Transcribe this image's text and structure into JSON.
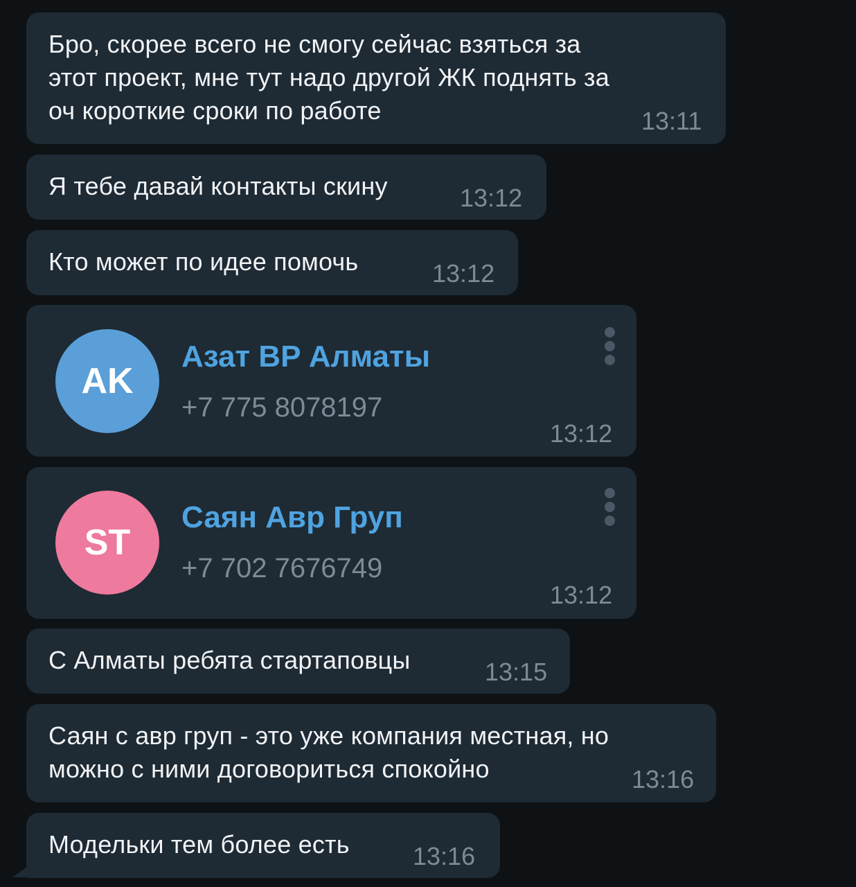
{
  "messages": [
    {
      "text": "Бро, скорее всего не смогу сейчас взяться за\nэтот проект, мне тут надо другой ЖК поднять за\nоч короткие сроки по работе",
      "time": "13:11"
    },
    {
      "text": "Я тебе давай контакты скину",
      "time": "13:12"
    },
    {
      "text": "Кто может по идее помочь",
      "time": "13:12"
    },
    {
      "text": "С Алматы ребята стартаповцы",
      "time": "13:15"
    },
    {
      "text": "Саян с авр груп - это уже компания местная, но\nможно с ними договориться спокойно",
      "time": "13:16"
    },
    {
      "text": "Модельки тем более есть",
      "time": "13:16"
    }
  ],
  "contacts": [
    {
      "initials": "AK",
      "name": "Азат BP Алматы",
      "phone": "+7 775 8078197",
      "time": "13:12",
      "avatar_color": "#5a9fd8",
      "icon": "more-vertical-icon"
    },
    {
      "initials": "ST",
      "name": "Саян Авр Груп",
      "phone": "+7 702 7676749",
      "time": "13:12",
      "avatar_color": "#ee7a9d",
      "icon": "more-vertical-icon"
    }
  ],
  "colors": {
    "background": "#0e1214",
    "bubble": "#1e2a34",
    "accent": "#4fa3e0",
    "timestamp": "#7e8b97"
  }
}
